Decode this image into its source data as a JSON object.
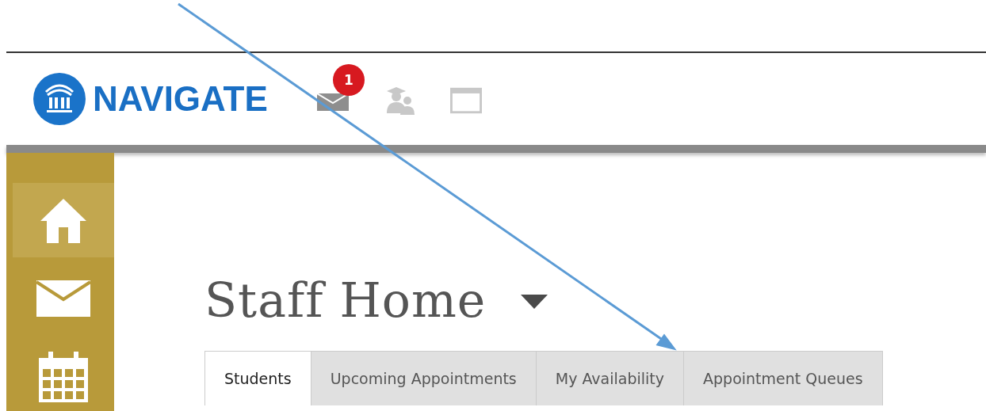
{
  "header": {
    "logo": "NAVIGATE",
    "notification_count": "1"
  },
  "sidebar": {
    "items": [
      {
        "kind": "home",
        "selected": true
      },
      {
        "kind": "mail",
        "selected": false
      },
      {
        "kind": "calendar",
        "selected": false
      }
    ]
  },
  "page": {
    "title": "Staff Home"
  },
  "tabs": [
    {
      "label": "Students",
      "selected": true
    },
    {
      "label": "Upcoming Appointments",
      "selected": false
    },
    {
      "label": "My Availability",
      "selected": false
    },
    {
      "label": "Appointment Queues",
      "selected": false
    }
  ]
}
